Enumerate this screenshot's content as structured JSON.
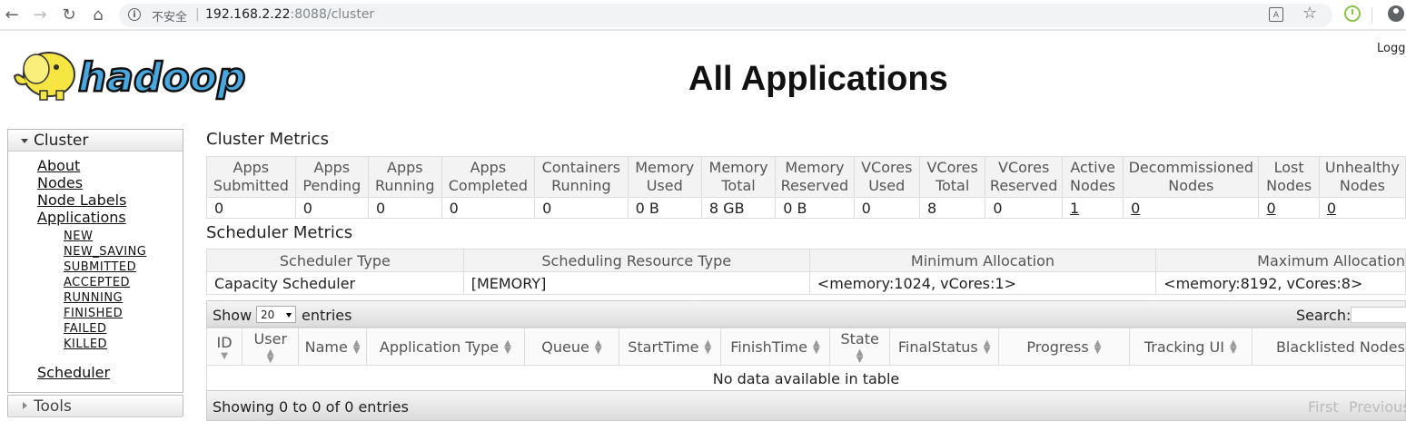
{
  "browser": {
    "insecure_label": "不安全",
    "url_host": "192.168.2.22",
    "url_rest": ":8088/cluster"
  },
  "header": {
    "title": "All Applications",
    "logged_in": "Logg"
  },
  "sidebar": {
    "cluster_label": "Cluster",
    "links": [
      "About",
      "Nodes",
      "Node Labels",
      "Applications"
    ],
    "app_states": [
      "NEW",
      "NEW_SAVING",
      "SUBMITTED",
      "ACCEPTED",
      "RUNNING",
      "FINISHED",
      "FAILED",
      "KILLED"
    ],
    "scheduler_label": "Scheduler",
    "tools_label": "Tools"
  },
  "cluster_metrics": {
    "title": "Cluster Metrics",
    "headers": [
      [
        "Apps",
        "Submitted"
      ],
      [
        "Apps",
        "Pending"
      ],
      [
        "Apps",
        "Running"
      ],
      [
        "Apps",
        "Completed"
      ],
      [
        "Containers",
        "Running"
      ],
      [
        "Memory",
        "Used"
      ],
      [
        "Memory",
        "Total"
      ],
      [
        "Memory",
        "Reserved"
      ],
      [
        "VCores",
        "Used"
      ],
      [
        "VCores",
        "Total"
      ],
      [
        "VCores",
        "Reserved"
      ],
      [
        "Active",
        "Nodes"
      ],
      [
        "Decommissioned",
        "Nodes"
      ],
      [
        "Lost",
        "Nodes"
      ],
      [
        "Unhealthy",
        "Nodes"
      ]
    ],
    "values": [
      "0",
      "0",
      "0",
      "0",
      "0",
      "0 B",
      "8 GB",
      "0 B",
      "0",
      "8",
      "0",
      "1",
      "0",
      "0",
      "0"
    ]
  },
  "scheduler_metrics": {
    "title": "Scheduler Metrics",
    "headers": [
      "Scheduler Type",
      "Scheduling Resource Type",
      "Minimum Allocation",
      "Maximum Allocation"
    ],
    "row": [
      "Capacity Scheduler",
      "[MEMORY]",
      "<memory:1024, vCores:1>",
      "<memory:8192, vCores:8>"
    ]
  },
  "apps_table": {
    "show_label": "Show",
    "page_size": "20",
    "entries_label": "entries",
    "search_label": "Search:",
    "headers": [
      "ID",
      "User",
      "Name",
      "Application Type",
      "Queue",
      "StartTime",
      "FinishTime",
      "State",
      "FinalStatus",
      "Progress",
      "Tracking UI",
      "Blacklisted Nodes"
    ],
    "empty_message": "No data available in table",
    "info": "Showing 0 to 0 of 0 entries",
    "first_label": "First",
    "previous_label": "Previous"
  }
}
